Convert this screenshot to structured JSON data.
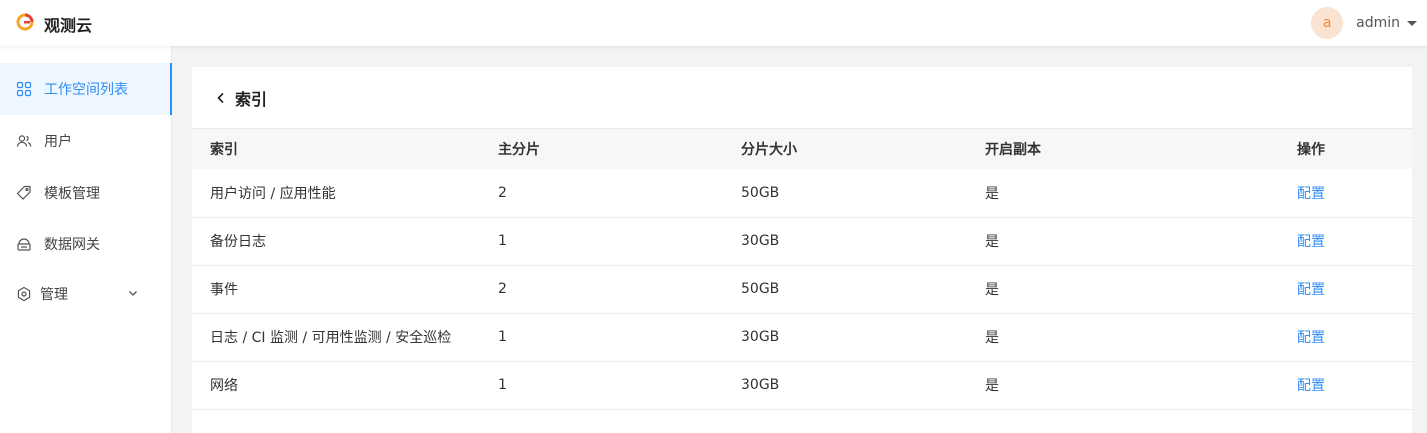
{
  "app": {
    "title": "观测云"
  },
  "user": {
    "avatar_letter": "a",
    "name": "admin"
  },
  "sidebar": {
    "items": [
      {
        "label": "工作空间列表",
        "icon": "grid-icon",
        "active": true
      },
      {
        "label": "用户",
        "icon": "users-icon",
        "active": false
      },
      {
        "label": "模板管理",
        "icon": "tag-icon",
        "active": false
      },
      {
        "label": "数据网关",
        "icon": "gateway-icon",
        "active": false
      },
      {
        "label": "管理",
        "icon": "settings-hex-icon",
        "active": false,
        "has_submenu": true
      }
    ]
  },
  "page": {
    "title": "索引"
  },
  "table": {
    "headers": [
      "索引",
      "主分片",
      "分片大小",
      "开启副本",
      "操作"
    ],
    "rows": [
      {
        "index": "用户访问 / 应用性能",
        "shards": "2",
        "size": "50GB",
        "replica": "是",
        "action": "配置"
      },
      {
        "index": "备份日志",
        "shards": "1",
        "size": "30GB",
        "replica": "是",
        "action": "配置"
      },
      {
        "index": "事件",
        "shards": "2",
        "size": "50GB",
        "replica": "是",
        "action": "配置"
      },
      {
        "index": "日志 / CI 监测 / 可用性监测 / 安全巡检",
        "shards": "1",
        "size": "30GB",
        "replica": "是",
        "action": "配置"
      },
      {
        "index": "网络",
        "shards": "1",
        "size": "30GB",
        "replica": "是",
        "action": "配置"
      }
    ]
  },
  "colors": {
    "accent": "#2f8ef4",
    "avatar_bg": "#fbe3d1",
    "avatar_fg": "#f08a3c"
  }
}
